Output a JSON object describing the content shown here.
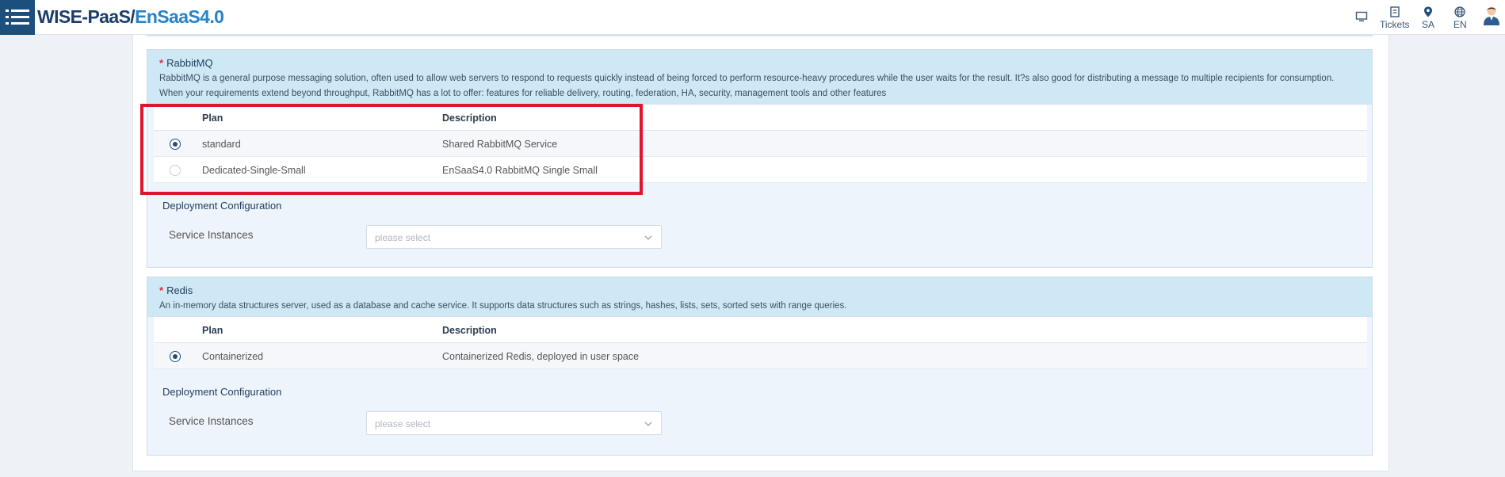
{
  "header": {
    "logo_part1": "WISE-PaaS/",
    "logo_part2": "EnSaaS4.0",
    "nav": {
      "monitor_icon": "monitor-icon",
      "tickets": "Tickets",
      "sa": "SA",
      "en": "EN"
    }
  },
  "rabbitmq": {
    "title": "RabbitMQ",
    "description": "RabbitMQ is a general purpose messaging solution, often used to allow web servers to respond to requests quickly instead of being forced to perform resource-heavy procedures while the user waits for the result. It?s also good for distributing a message to multiple recipients for consumption. When your requirements extend beyond throughput, RabbitMQ has a lot to offer: features for reliable delivery, routing, federation, HA, security, management tools and other features",
    "columns": [
      "Plan",
      "Description"
    ],
    "plans": [
      {
        "plan": "standard",
        "description": "Shared RabbitMQ Service",
        "selected": true
      },
      {
        "plan": "Dedicated-Single-Small",
        "description": "EnSaaS4.0 RabbitMQ Single Small",
        "selected": false
      }
    ],
    "deployment_title": "Deployment Configuration",
    "service_instances_label": "Service Instances",
    "service_instances_placeholder": "please select"
  },
  "redis": {
    "title": "Redis",
    "description": "An in-memory data structures server, used as a database and cache service. It supports data structures such as strings, hashes, lists, sets, sorted sets with range queries.",
    "columns": [
      "Plan",
      "Description"
    ],
    "plans": [
      {
        "plan": "Containerized",
        "description": "Containerized Redis, deployed in user space",
        "selected": true
      }
    ],
    "deployment_title": "Deployment Configuration",
    "service_instances_label": "Service Instances",
    "service_instances_placeholder": "please select"
  },
  "colors": {
    "brand_dark": "#1c4f7c",
    "brand_light": "#2783c8",
    "section_header_bg": "#cfe8f6",
    "highlight": "#e0142b",
    "required_star": "#e3263b"
  }
}
